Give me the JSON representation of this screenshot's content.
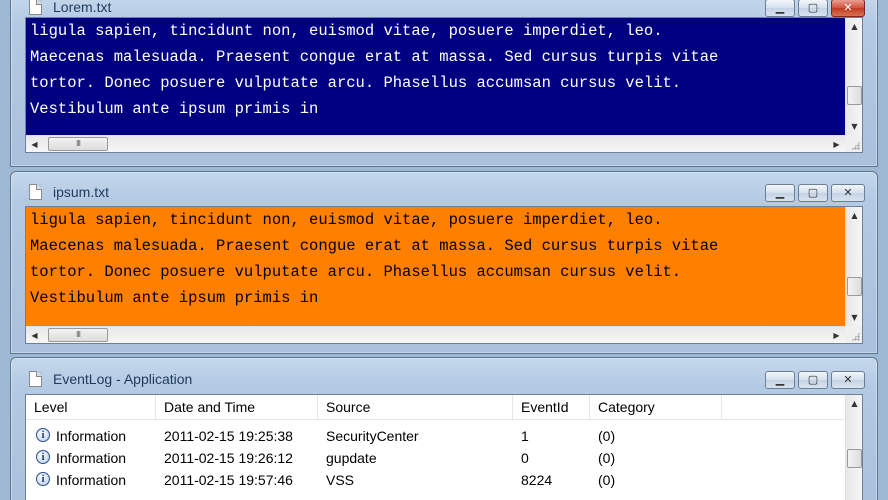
{
  "windows": [
    {
      "title": "Lorem.txt",
      "lines": [
        "ligula sapien, tincidunt non, euismod vitae, posuere imperdiet, leo.",
        "Maecenas malesuada. Praesent congue erat at massa. Sed cursus turpis vitae",
        "tortor. Donec posuere vulputate arcu. Phasellus accumsan cursus velit.",
        "Vestibulum ante ipsum primis in"
      ],
      "background": "#000080",
      "text_color": "#ffffff"
    },
    {
      "title": "ipsum.txt",
      "lines": [
        "ligula sapien, tincidunt non, euismod vitae, posuere imperdiet, leo.",
        "Maecenas malesuada. Praesent congue erat at massa. Sed cursus turpis vitae",
        "tortor. Donec posuere vulputate arcu. Phasellus accumsan cursus velit.",
        "Vestibulum ante ipsum primis in"
      ],
      "background": "#ff8000",
      "text_color": "#000000"
    }
  ],
  "eventlog": {
    "title": "EventLog - Application",
    "columns": [
      "Level",
      "Date and Time",
      "Source",
      "EventId",
      "Category"
    ],
    "rows": [
      {
        "level": "Information",
        "datetime": "2011-02-15 19:25:38",
        "source": "SecurityCenter",
        "eventid": "1",
        "category": "(0)"
      },
      {
        "level": "Information",
        "datetime": "2011-02-15 19:26:12",
        "source": "gupdate",
        "eventid": "0",
        "category": "(0)"
      },
      {
        "level": "Information",
        "datetime": "2011-02-15 19:57:46",
        "source": "VSS",
        "eventid": "8224",
        "category": "(0)"
      }
    ]
  },
  "icons": {
    "minimize": "minimize-icon",
    "maximize": "maximize-icon",
    "close": "close-icon",
    "document": "document-icon",
    "information": "information-icon"
  },
  "glyphs": {
    "minimize": "▁",
    "maximize": "▢",
    "close": "✕",
    "arrow_up": "▲",
    "arrow_down": "▼",
    "arrow_left": "◀",
    "arrow_right": "▶",
    "grip": "III",
    "info": "i"
  }
}
